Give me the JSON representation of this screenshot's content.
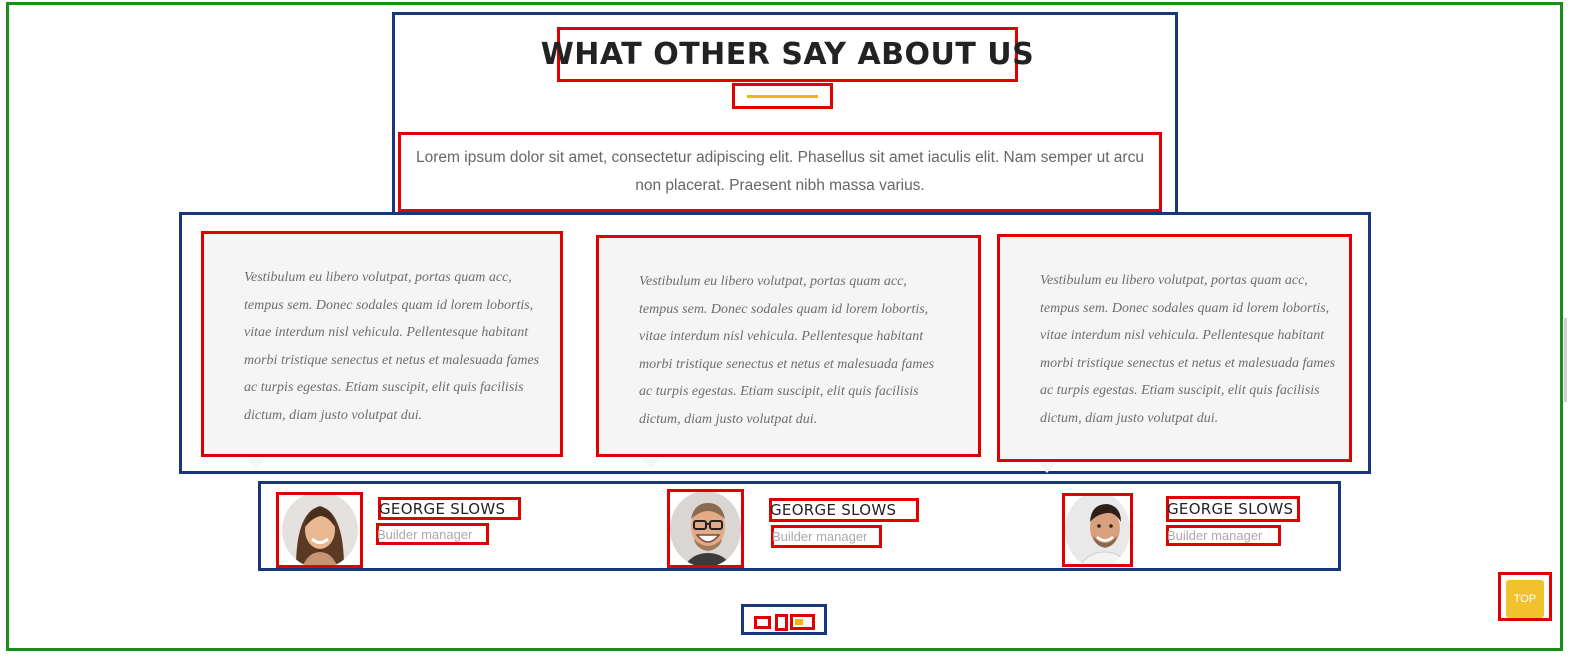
{
  "section": {
    "title": "WHAT OTHER SAY ABOUT US",
    "intro": "Lorem ipsum dolor sit amet, consectetur adipiscing elit. Phasellus sit amet iaculis elit. Nam semper ut arcu non placerat. Praesent nibh massa varius."
  },
  "testimonials": [
    {
      "quote": "Vestibulum eu libero volutpat, portas quam acc, tempus sem. Donec sodales quam id lorem lobortis, vitae interdum nisl vehicula. Pellentesque habitant morbi tristique senectus et netus et malesuada fames ac turpis egestas. Etiam suscipit, elit quis facilisis dictum, diam justo volutpat dui.",
      "name": "GEORGE SLOWS",
      "role": "Builder manager",
      "avatar": "woman-portrait"
    },
    {
      "quote": "Vestibulum eu libero volutpat, portas quam acc, tempus sem. Donec sodales quam id lorem lobortis, vitae interdum nisl vehicula. Pellentesque habitant morbi tristique senectus et netus et malesuada fames ac turpis egestas. Etiam suscipit, elit quis facilisis dictum, diam justo volutpat dui.",
      "name": "GEORGE SLOWS",
      "role": "Builder manager",
      "avatar": "man-glasses-portrait"
    },
    {
      "quote": "Vestibulum eu libero volutpat, portas quam acc, tempus sem. Donec sodales quam id lorem lobortis, vitae interdum nisl vehicula. Pellentesque habitant morbi tristique senectus et netus et malesuada fames ac turpis egestas. Etiam suscipit, elit quis facilisis dictum, diam justo volutpat dui.",
      "name": "GEORGE SLOWS",
      "role": "Builder manager",
      "avatar": "man-smiling-portrait"
    }
  ],
  "pagination": {
    "pages": 3,
    "active": 3
  },
  "scroll_top": {
    "label": "TOP"
  },
  "colors": {
    "accent": "#f2b705",
    "frame_outer": "#1a8f1a",
    "frame_group": "#17377a",
    "frame_element": "#e00000"
  }
}
